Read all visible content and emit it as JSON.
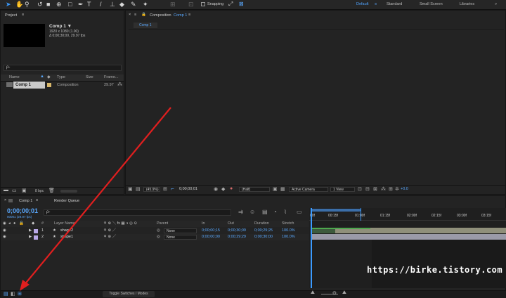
{
  "toolbar": {
    "tools": [
      "selection-tool",
      "hand-tool",
      "zoom-tool",
      "rotate-tool",
      "camera-tool",
      "pan-behind-tool",
      "rectangle-tool",
      "pen-tool",
      "type-tool",
      "brush-tool",
      "clone-stamp-tool",
      "eraser-tool",
      "roto-brush-tool",
      "puppet-pin-tool"
    ],
    "snapping_label": "Snapping",
    "workspaces": [
      "Default",
      "Standard",
      "Small Screen",
      "Libraries"
    ],
    "active_workspace": "Default"
  },
  "project": {
    "panel_title": "Project",
    "comp_name": "Comp 1 ▼",
    "comp_info_1": "1920 x 1080 (1.00)",
    "comp_info_2": "Δ 0;00;30;00, 29.97 fps",
    "search_placeholder": "ρ-",
    "columns": [
      "Name",
      "Type",
      "Size",
      "Frame..."
    ],
    "items": [
      {
        "name": "Comp 1",
        "type": "Composition",
        "size": "",
        "fps": "29.97"
      }
    ],
    "bpc": "8 bpc"
  },
  "composition": {
    "panel_title": "Composition",
    "comp_link": "Comp 1",
    "comp_tab": "Comp 1",
    "footer": {
      "zoom": "(45.9%)",
      "timecode": "0;00;00;01",
      "resolution": "(Half)",
      "camera": "Active Camera",
      "views": "1 View",
      "exposure": "+0.0"
    }
  },
  "timeline": {
    "comp_tab": "Comp 1",
    "render_queue_tab": "Render Queue",
    "current_time": "0;00;00;01",
    "current_time_sub": "00001 (29.97 fps)",
    "search_placeholder": "ρ-",
    "headers": {
      "num": "#",
      "layer_name": "Layer Name",
      "parent": "Parent",
      "in": "In",
      "out": "Out",
      "duration": "Duration",
      "stretch": "Stretch"
    },
    "layers": [
      {
        "num": "1",
        "name": "shape2",
        "parent": "None",
        "in": "0;00;00;15",
        "out": "0;00;30;09",
        "duration": "0;00;29;25",
        "stretch": "100.0%",
        "color": "#b9a8e8"
      },
      {
        "num": "2",
        "name": "shape1",
        "parent": "None",
        "in": "0;00;00;00",
        "out": "0;00;29;29",
        "duration": "0;00;30;00",
        "stretch": "100.0%",
        "color": "#b9a8e8"
      }
    ],
    "ruler_ticks": [
      "00f",
      "00:15f",
      "01:00f",
      "01:15f",
      "02:00f",
      "02:15f",
      "03:00f",
      "03:15f"
    ],
    "toggle_label": "Toggle Switches / Modes"
  },
  "watermark": "https://birke.tistory.com",
  "annotation_color": "#e01f1f",
  "accent_color": "#3b9bff"
}
